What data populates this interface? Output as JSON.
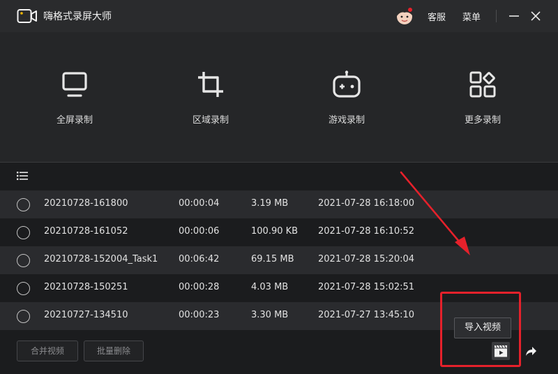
{
  "app": {
    "title": "嗨格式录屏大师"
  },
  "titlebar": {
    "support_label": "客服",
    "menu_label": "菜单"
  },
  "modes": [
    {
      "label": "全屏录制",
      "icon": "monitor-icon"
    },
    {
      "label": "区域录制",
      "icon": "crop-icon"
    },
    {
      "label": "游戏录制",
      "icon": "gamepad-icon"
    },
    {
      "label": "更多录制",
      "icon": "grid-more-icon"
    }
  ],
  "recordings": [
    {
      "name": "20210728-161800",
      "duration": "00:00:04",
      "size": "3.19 MB",
      "date": "2021-07-28 16:18:00"
    },
    {
      "name": "20210728-161052",
      "duration": "00:00:06",
      "size": "100.90 KB",
      "date": "2021-07-28 16:10:52"
    },
    {
      "name": "20210728-152004_Task1",
      "duration": "00:06:42",
      "size": "69.15 MB",
      "date": "2021-07-28 15:20:04"
    },
    {
      "name": "20210728-150251",
      "duration": "00:00:28",
      "size": "4.03 MB",
      "date": "2021-07-28 15:02:51"
    },
    {
      "name": "20210727-134510",
      "duration": "00:00:23",
      "size": "3.30 MB",
      "date": "2021-07-27 13:45:10"
    }
  ],
  "footer": {
    "merge_label": "合并视频",
    "batch_delete_label": "批量删除",
    "import_tooltip": "导入视频"
  },
  "colors": {
    "background": "#1b1c1e",
    "titlebar": "#2a2b2d",
    "panel": "#252628",
    "row_alt": "#2a2b2e",
    "highlight_red": "#e5212b"
  }
}
